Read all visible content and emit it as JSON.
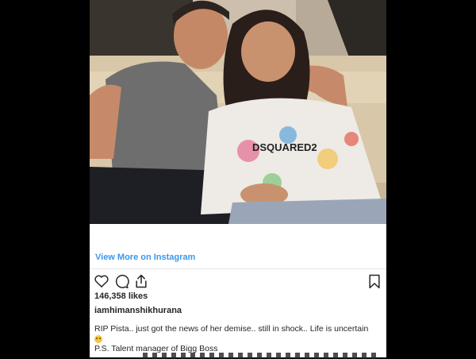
{
  "post": {
    "view_more": "View More on Instagram",
    "likes": "146,358 likes",
    "username": "iamhimanshikhurana",
    "caption_text": "RIP Pista.. just got the news of her demise.. still in shock.. Life is uncertain",
    "caption_ps": "P.S. Talent manager of Bigg Boss",
    "shirt_text": "DSQUARED2"
  },
  "icons": {
    "like": "heart-icon",
    "comment": "comment-icon",
    "share": "share-icon",
    "save": "bookmark-icon",
    "emoji": "sad-face-emoji-icon"
  },
  "colors": {
    "background": "#000000",
    "card": "#ffffff",
    "link": "#3897f0",
    "text": "#262626"
  }
}
